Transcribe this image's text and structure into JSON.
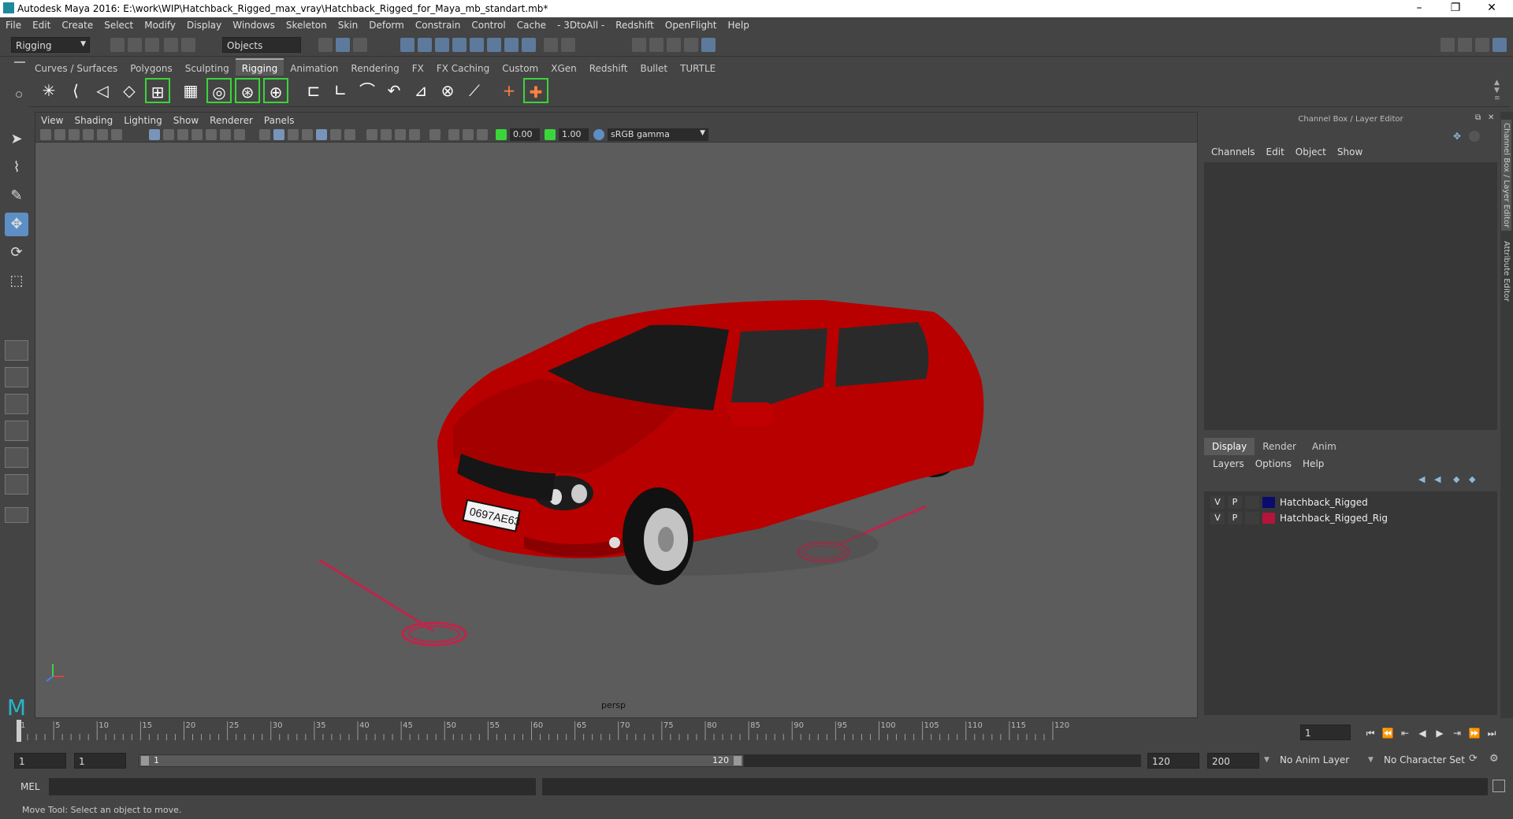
{
  "window": {
    "title": "Autodesk Maya 2016: E:\\work\\WIP\\Hatchback_Rigged_max_vray\\Hatchback_Rigged_for_Maya_mb_standart.mb*",
    "minimize": "–",
    "maximize": "❐",
    "close": "✕"
  },
  "menubar": [
    "File",
    "Edit",
    "Create",
    "Select",
    "Modify",
    "Display",
    "Windows",
    "Skeleton",
    "Skin",
    "Deform",
    "Constrain",
    "Control",
    "Cache",
    "- 3DtoAll -",
    "Redshift",
    "OpenFlight",
    "Help"
  ],
  "status": {
    "mode": "Rigging",
    "selection_mode": "Objects"
  },
  "shelf_tabs": [
    "Curves / Surfaces",
    "Polygons",
    "Sculpting",
    "Rigging",
    "Animation",
    "Rendering",
    "FX",
    "FX Caching",
    "Custom",
    "XGen",
    "Redshift",
    "Bullet",
    "TURTLE"
  ],
  "shelf_active": "Rigging",
  "viewport": {
    "menu": [
      "View",
      "Shading",
      "Lighting",
      "Show",
      "Renderer",
      "Panels"
    ],
    "exposure": "0.00",
    "gamma": "1.00",
    "colorspace": "sRGB gamma",
    "camera": "persp",
    "plate": "0697AE63"
  },
  "channel_box": {
    "title": "Channel Box / Layer Editor",
    "menu": [
      "Channels",
      "Edit",
      "Object",
      "Show"
    ],
    "layer_tabs": [
      "Display",
      "Render",
      "Anim"
    ],
    "layer_active": "Display",
    "layer_menu": [
      "Layers",
      "Options",
      "Help"
    ],
    "layers": [
      {
        "v": "V",
        "p": "P",
        "name": "Hatchback_Rigged",
        "color": "#0b0b6e"
      },
      {
        "v": "V",
        "p": "P",
        "name": "Hatchback_Rigged_Rig",
        "color": "#b4143c"
      }
    ],
    "side_tab_1": "Channel Box / Layer Editor",
    "side_tab_2": "Attribute Editor"
  },
  "timeline": {
    "ticks": [
      1,
      5,
      10,
      15,
      20,
      25,
      30,
      35,
      40,
      45,
      50,
      55,
      60,
      65,
      70,
      75,
      80,
      85,
      90,
      95,
      100,
      105,
      110,
      115,
      120
    ],
    "current_frame": "1"
  },
  "range": {
    "start": "1",
    "playback_start": "1",
    "slider_start": "1",
    "slider_end": "120",
    "playback_end": "120",
    "end": "200",
    "anim_layer": "No Anim Layer",
    "character_set": "No Character Set"
  },
  "cmdline": {
    "label": "MEL"
  },
  "helpline": {
    "text": "Move Tool: Select an object to move."
  },
  "colors": {
    "car_body": "#b80000",
    "rig_control": "#c0244a"
  }
}
